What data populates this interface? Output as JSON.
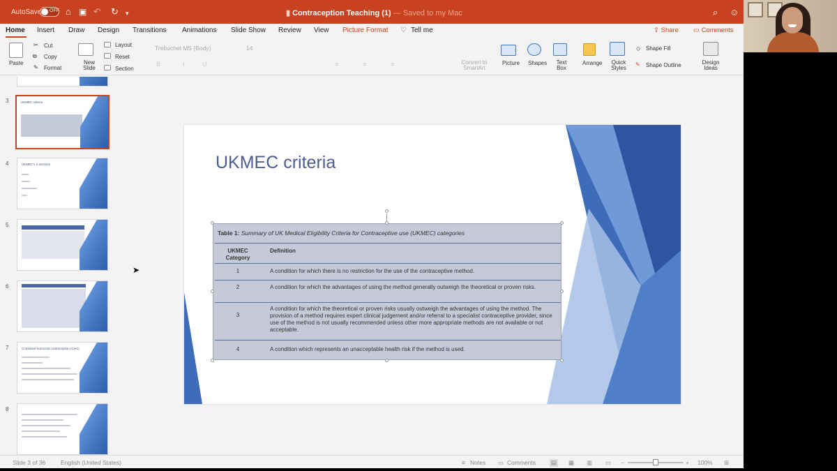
{
  "window": {
    "autosave_label": "AutoSave",
    "autosave_state": "OFF",
    "doc_title": "Contraception Teaching (1)",
    "doc_title_suffix": "— Saved to my Mac"
  },
  "tabs": [
    "Home",
    "Insert",
    "Draw",
    "Design",
    "Transitions",
    "Animations",
    "Slide Show",
    "Review",
    "View",
    "Picture Format",
    "Tell me"
  ],
  "share_label": "Share",
  "comments_label": "Comments",
  "ribbon": {
    "paste": "Paste",
    "cut": "Cut",
    "copy": "Copy",
    "format": "Format",
    "new_slide": "New Slide",
    "layout": "Layout",
    "reset": "Reset",
    "section": "Section",
    "font_name": "Trebuchet MS (Body)",
    "font_size": "14",
    "convert": "Convert to SmartArt",
    "picture": "Picture",
    "shapes": "Shapes",
    "text_box": "Text Box",
    "arrange": "Arrange",
    "quick_styles": "Quick Styles",
    "shape_fill": "Shape Fill",
    "shape_outline": "Shape Outline",
    "design_ideas": "Design Ideas"
  },
  "thumbnails": [
    {
      "num": "3",
      "title": "UKMEC criteria"
    },
    {
      "num": "4",
      "title": "UKMEC's 4 sections"
    },
    {
      "num": "5",
      "title": ""
    },
    {
      "num": "6",
      "title": ""
    },
    {
      "num": "7",
      "title": "Combined hormonal contraception (CHC)"
    },
    {
      "num": "8",
      "title": ""
    }
  ],
  "slide": {
    "title": "UKMEC criteria",
    "table": {
      "caption_bold": "Table 1:",
      "caption_italic": "Summary of UK Medical Eligibility Criteria for Contraceptive use (UKMEC) categories",
      "col1": "UKMEC Category",
      "col2": "Definition",
      "rows": [
        {
          "cat": "1",
          "def": "A condition for which there is no restriction for the use of the contraceptive method."
        },
        {
          "cat": "2",
          "def": "A condition for which the advantages of using the method generally outweigh the theoretical or proven risks."
        },
        {
          "cat": "3",
          "def": "A condition for which the theoretical or proven risks usually outweigh the advantages of using the method. The provision of a method requires expert clinical judgement and/or referral to a specialist contraceptive provider, since use of the method is not usually recommended unless other more appropriate methods are not available or not acceptable."
        },
        {
          "cat": "4",
          "def": "A condition which represents an unacceptable health risk if the method is used."
        }
      ]
    }
  },
  "status": {
    "slide_pos": "Slide 3 of 36",
    "language": "English (United States)",
    "notes": "Notes",
    "comments": "Comments",
    "zoom": "100%"
  },
  "colors": {
    "accent": "#c8421f",
    "slide_title": "#4b5d90",
    "table_fill": "#c6cad8"
  }
}
